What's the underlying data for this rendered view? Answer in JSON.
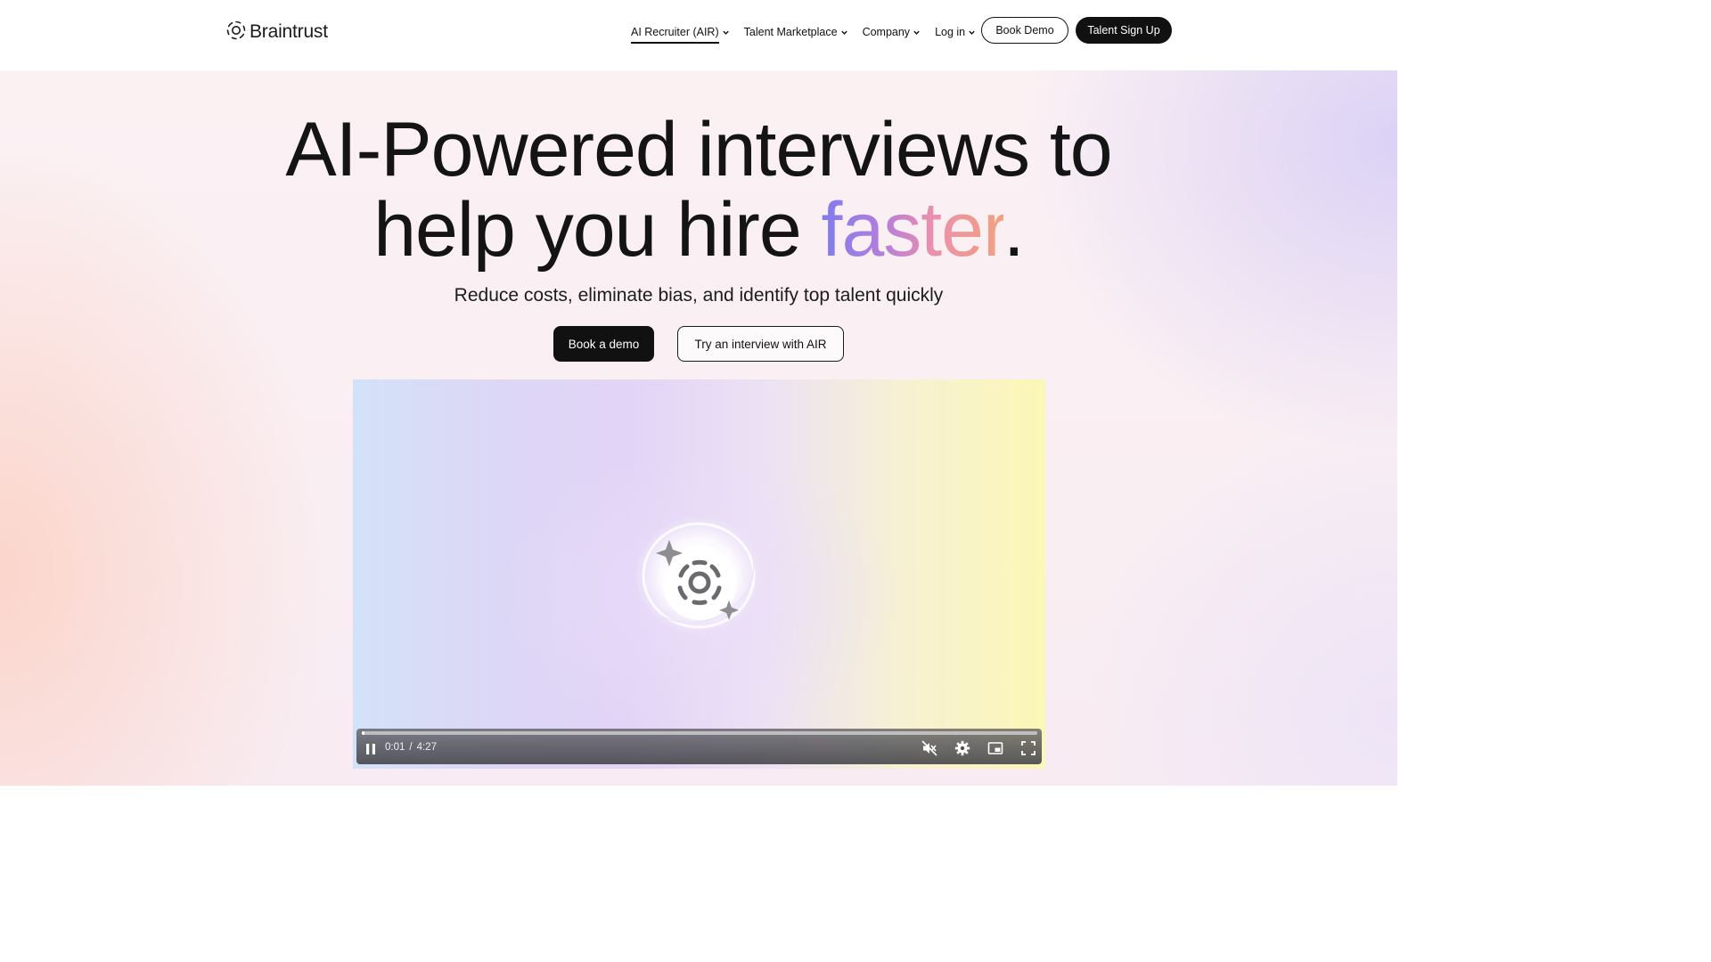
{
  "brand": {
    "name": "Braintrust",
    "logo_icon": "braintrust-gear-icon"
  },
  "nav": {
    "items": [
      {
        "label": "AI Recruiter (AIR)",
        "active": true,
        "icon": "chevron-down-icon"
      },
      {
        "label": "Talent Marketplace",
        "active": false,
        "icon": "chevron-down-icon"
      },
      {
        "label": "Company",
        "active": false,
        "icon": "chevron-down-icon"
      },
      {
        "label": "Log in",
        "active": false,
        "icon": "chevron-down-icon"
      }
    ],
    "book_demo": "Book Demo",
    "talent_sign_up": "Talent Sign Up"
  },
  "hero": {
    "headline_line1": "AI-Powered interviews to",
    "headline_line2_prefix": "help you hire ",
    "headline_highlight": "faster",
    "headline_suffix": ".",
    "subheadline": "Reduce costs, eliminate bias, and identify top talent quickly",
    "primary_cta": "Book a demo",
    "secondary_cta": "Try an interview with AIR"
  },
  "video": {
    "current_time": "0:01",
    "separator": "/",
    "duration": "4:27",
    "progress_fraction": 0.004,
    "playing": true,
    "muted": true,
    "icons": [
      "pause-icon",
      "mute-icon",
      "settings-gear-icon",
      "picture-in-picture-icon",
      "fullscreen-icon"
    ]
  },
  "colors": {
    "text": "#111111",
    "button_dark": "#111111",
    "faster_gradient": [
      "#7f7cf0",
      "#b67fd8",
      "#e98fb0",
      "#f2a27e"
    ]
  }
}
